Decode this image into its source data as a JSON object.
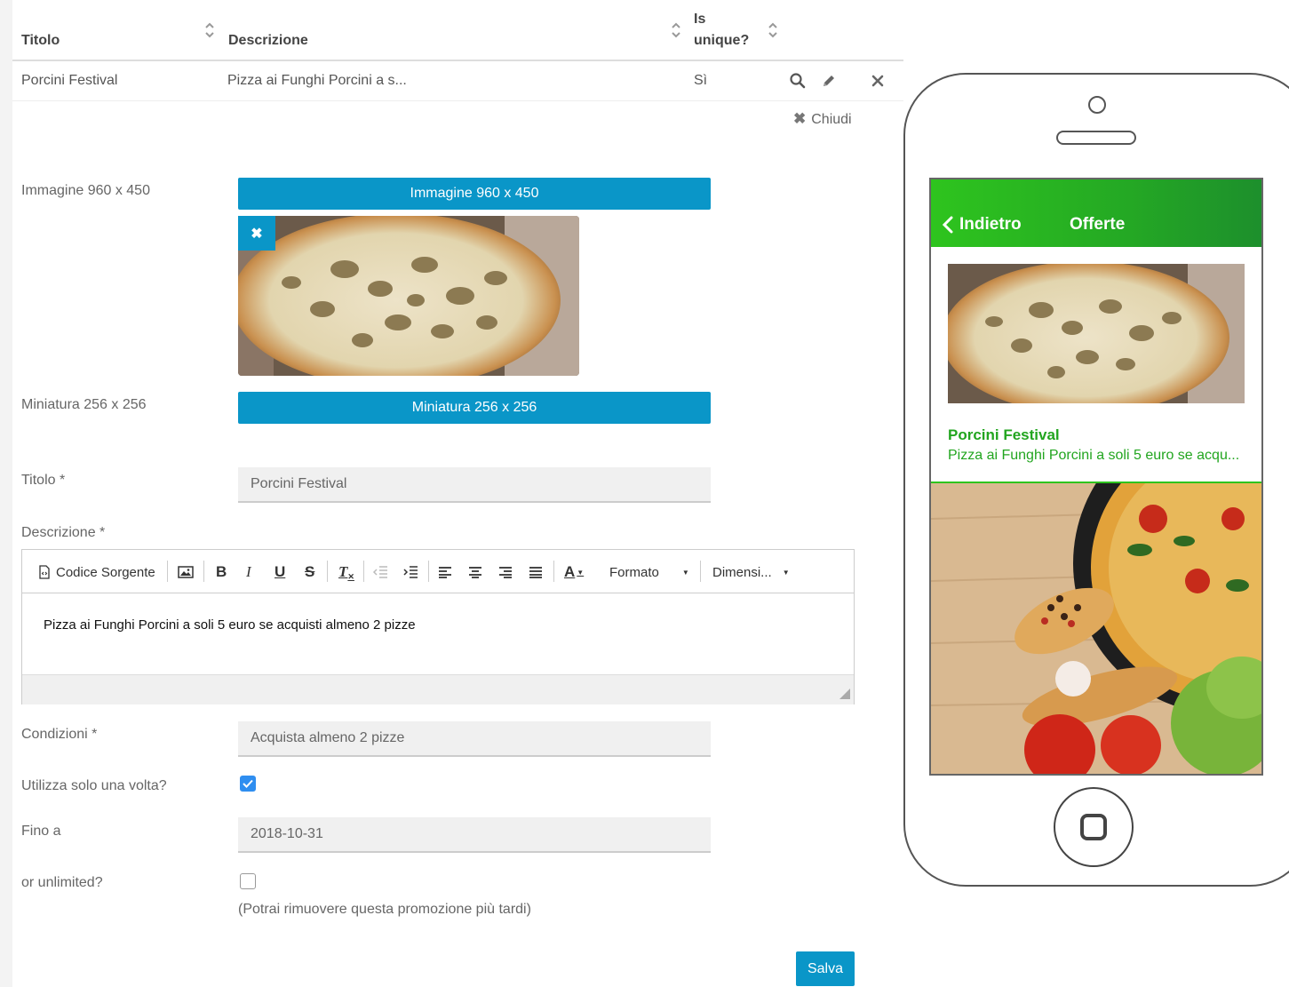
{
  "table": {
    "columns": [
      {
        "label": "Titolo"
      },
      {
        "label": "Descrizione"
      },
      {
        "label_line1": "Is",
        "label_line2": "unique?"
      }
    ],
    "rows": [
      {
        "titolo": "Porcini Festival",
        "descrizione": "Pizza ai Funghi Porcini a s...",
        "unique": "Sì"
      }
    ],
    "icons": [
      "search-icon",
      "pencil-icon",
      "delete-icon"
    ]
  },
  "close_label": "Chiudi",
  "form": {
    "image_label": "Immagine 960 x 450",
    "image_button": "Immagine 960 x 450",
    "thumb_label": "Miniatura 256 x 256",
    "thumb_button": "Miniatura 256 x 256",
    "title_label": "Titolo *",
    "title_value": "Porcini Festival",
    "desc_label": "Descrizione *",
    "editor": {
      "source_label": "Codice Sorgente",
      "bold": "B",
      "italic": "I",
      "underline": "U",
      "strike": "S",
      "clear_format": "T",
      "font_color": "A",
      "format_label": "Formato",
      "size_label": "Dimensi...",
      "content": "Pizza ai Funghi Porcini a soli 5 euro se acquisti almeno 2 pizze"
    },
    "conditions_label": "Condizioni *",
    "conditions_value": "Acquista almeno 2 pizze",
    "once_label": "Utilizza solo una volta?",
    "once_checked": true,
    "until_label": "Fino a",
    "until_value": "2018-10-31",
    "unlimited_label": "or unlimited?",
    "unlimited_checked": false,
    "note": "(Potrai rimuovere questa promozione più tardi)",
    "save_label": "Salva"
  },
  "preview": {
    "back_label": "Indietro",
    "header_title": "Offerte",
    "card_title": "Porcini Festival",
    "card_desc": "Pizza ai Funghi Porcini a soli 5 euro se acqu...",
    "accent_color": "#2ec41e",
    "button_color": "#0a96c8"
  }
}
